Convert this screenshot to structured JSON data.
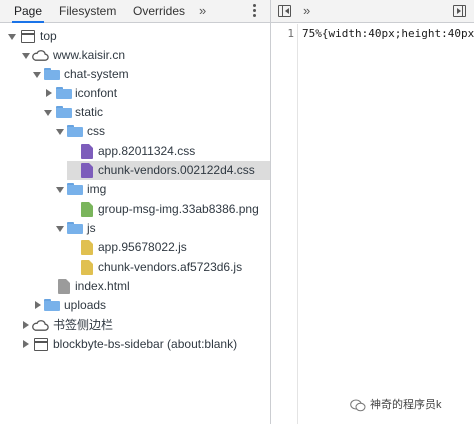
{
  "tabs": {
    "page": "Page",
    "filesystem": "Filesystem",
    "overrides": "Overrides",
    "more": "»"
  },
  "right_toolbar": {
    "more": "»"
  },
  "tree": {
    "top": "top",
    "domain": "www.kaisir.cn",
    "chat_system": "chat-system",
    "iconfont": "iconfont",
    "static": "static",
    "css": "css",
    "css_file_1": "app.82011324.css",
    "css_file_2": "chunk-vendors.002122d4.css",
    "img": "img",
    "img_file_1": "group-msg-img.33ab8386.png",
    "js": "js",
    "js_file_1": "app.95678022.js",
    "js_file_2": "chunk-vendors.af5723d6.js",
    "index_html": "index.html",
    "uploads": "uploads",
    "bookmark": "书签侧边栏",
    "blockbyte": "blockbyte-bs-sidebar (about:blank)"
  },
  "editor": {
    "line_number": "1",
    "line_text": "75%{width:40px;height:40px"
  },
  "watermark": {
    "text": "神奇的程序员k"
  },
  "colors": {
    "selected_row": "#dcdcdc",
    "folder": "#78b1ea",
    "css_file": "#7d5dbb",
    "img_file": "#7ab55c",
    "js_file": "#e0c050",
    "html_file": "#9b9b9b"
  }
}
